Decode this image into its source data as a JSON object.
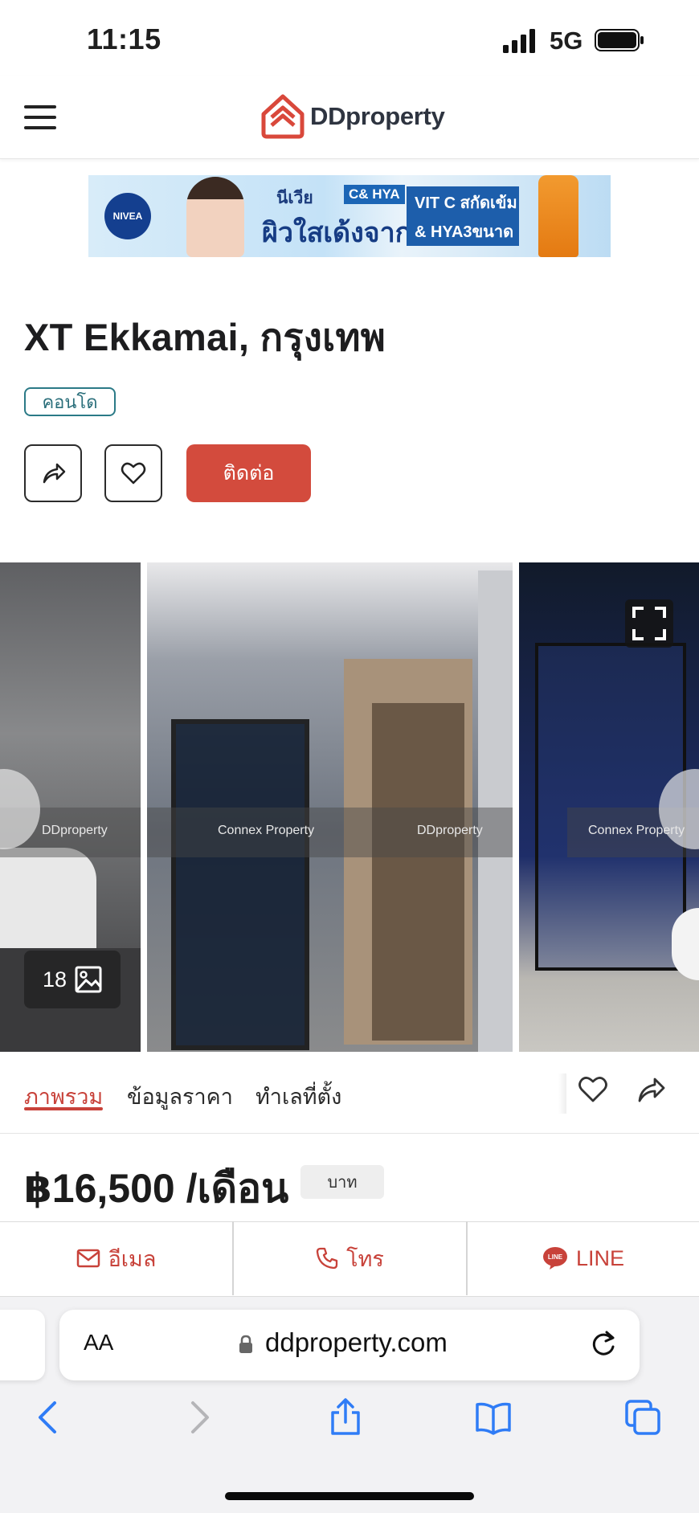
{
  "status_bar": {
    "time": "11:15",
    "network": "5G"
  },
  "header": {
    "logo_text": "DDproperty",
    "menu_icon": "hamburger-icon",
    "logo_icon": "ddproperty-logo-icon"
  },
  "ad_banner": {
    "brand": "NIVEA",
    "line1": "นีเวีย",
    "tag": "C& HYA",
    "line2": "ผิวใสเด้งจาก",
    "box_line1": "VIT C สกัดเข้ม",
    "box_line2": "& HYA3ขนาด"
  },
  "listing": {
    "title": "XT Ekkamai, กรุงเทพ",
    "type_tag": "คอนโด",
    "contact_button": "ติดต่อ"
  },
  "gallery": {
    "photo_count": "18",
    "watermark_brand": "DDproperty",
    "watermark_agent": "Connex Property"
  },
  "tabs": [
    {
      "label": "ภาพรวม",
      "active": true
    },
    {
      "label": "ข้อมูลราคา",
      "active": false
    },
    {
      "label": "ทำเลที่ตั้ง",
      "active": false
    }
  ],
  "price": {
    "amount": "฿16,500 /เดือน",
    "unit_badge": "บาท"
  },
  "contact_bar": {
    "email": "อีเมล",
    "phone": "โทร",
    "line": "LINE"
  },
  "safari": {
    "aa": "AA",
    "url": "ddproperty.com"
  },
  "colors": {
    "accent": "#d34b3d",
    "teal": "#2b7a87",
    "text": "#1d1d1f"
  }
}
